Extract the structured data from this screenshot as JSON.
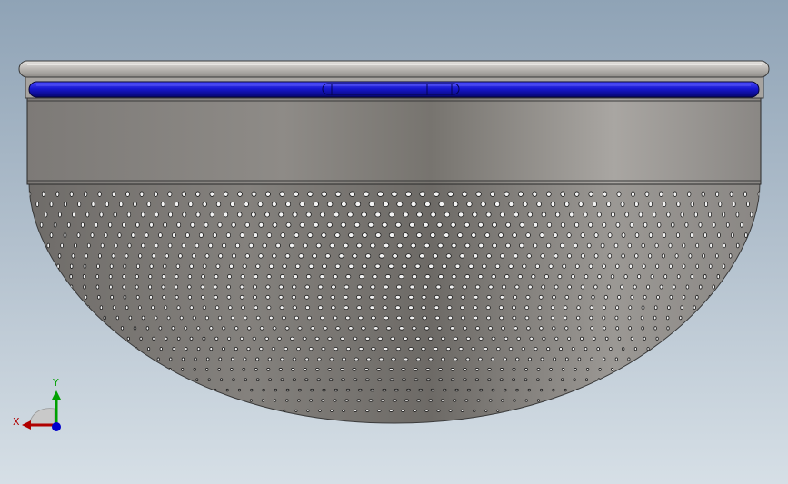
{
  "triad": {
    "x_label": "X",
    "y_label": "Y",
    "x_color": "#b00000",
    "y_color": "#00a000",
    "z_color": "#0000cc"
  },
  "model": {
    "name_icon": "strainer-bowl-icon",
    "body_color": "#8a8784",
    "seal_color": "#1a1ad0",
    "perforation_color": "#f4f4f4"
  }
}
